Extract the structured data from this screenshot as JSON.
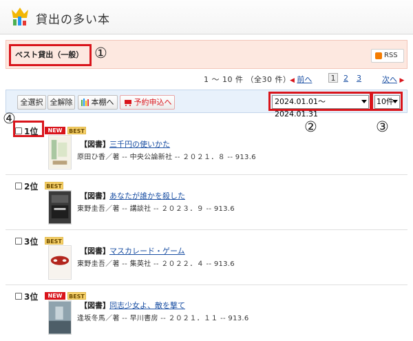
{
  "header": {
    "title": "貸出の多い本",
    "logo_icon": "crown-bar-chart-icon"
  },
  "category": {
    "label": "ベスト貸出（一般）",
    "annotation": "①",
    "rss_label": "RSS"
  },
  "pager": {
    "result_count": "1 ～ 10 件 （全30 件）",
    "prev_label": "前へ",
    "pages": [
      "1",
      "2",
      "3"
    ],
    "current_page": "1",
    "next_label": "次へ"
  },
  "toolbar": {
    "select_all": "全選択",
    "deselect_all": "全解除",
    "shelf": "本棚へ",
    "reserve": "予約申込へ",
    "period_value": "2024.01.01～2024.01.31",
    "count_value": "10件",
    "annotation_period": "②",
    "annotation_count": "③",
    "annotation_rank": "④"
  },
  "colors": {
    "accent_red": "#d9141b",
    "link_blue": "#1a4fa3",
    "category_bg": "#fde8e0",
    "toolbar_bg": "#e8f1fb",
    "badge_best": "#f8d26a"
  },
  "items": [
    {
      "rank": "1位",
      "badges": [
        "NEW",
        "BEST"
      ],
      "type": "【図書】",
      "title": "三千円の使いかた",
      "meta": "原田ひ香／著 -- 中央公論新社 -- ２０２１．８ -- 913.6"
    },
    {
      "rank": "2位",
      "badges": [
        "BEST"
      ],
      "type": "【図書】",
      "title": "あなたが誰かを殺した",
      "meta": "東野圭吾／著 -- 講談社 -- ２０２３．９ -- 913.6"
    },
    {
      "rank": "3位",
      "badges": [
        "BEST"
      ],
      "type": "【図書】",
      "title": "マスカレード・ゲーム",
      "meta": "東野圭吾／著 -- 集英社 -- ２０２２．４ -- 913.6"
    },
    {
      "rank": "3位",
      "badges": [
        "NEW",
        "BEST"
      ],
      "type": "【図書】",
      "title": "同志少女よ、敵を撃て",
      "meta": "逢坂冬馬／著 -- 早川書房 -- ２０２１．１１ -- 913.6"
    }
  ]
}
